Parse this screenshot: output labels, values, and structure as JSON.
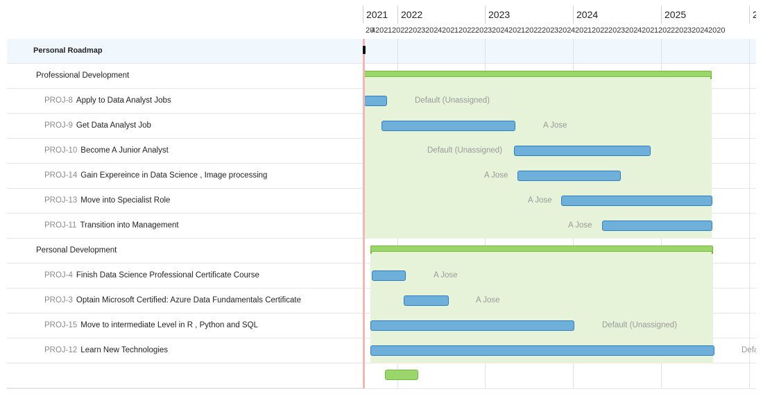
{
  "roadmap": {
    "title": "Personal Roadmap",
    "groups": [
      {
        "name": "Professional Development",
        "items": [
          {
            "key": "PROJ-8",
            "name": "Apply to Data Analyst Jobs",
            "assignee": "Default (Unassigned)"
          },
          {
            "key": "PROJ-9",
            "name": "Get Data Analyst Job",
            "assignee": "A Jose"
          },
          {
            "key": "PROJ-10",
            "name": "Become A Junior Analyst",
            "assignee": "Default (Unassigned)"
          },
          {
            "key": "PROJ-14",
            "name": "Gain Expereince in Data Science , Image processing",
            "assignee": "A Jose"
          },
          {
            "key": "PROJ-13",
            "name": "Move into Specialist Role",
            "assignee": "A Jose"
          },
          {
            "key": "PROJ-11",
            "name": "Transition into Management",
            "assignee": "A Jose"
          }
        ]
      },
      {
        "name": "Personal Development",
        "items": [
          {
            "key": "PROJ-4",
            "name": "Finish Data Science Professional Certificate Course",
            "assignee": "A Jose"
          },
          {
            "key": "PROJ-3",
            "name": "Optain Microsoft Certified: Azure Data Fundamentals Certificate",
            "assignee": "A Jose"
          },
          {
            "key": "PROJ-15",
            "name": "Move to intermediate Level in R , Python and SQL",
            "assignee": "Default (Unassigned)"
          },
          {
            "key": "PROJ-12",
            "name": "Learn New Technologies",
            "assignee": "Defa"
          }
        ]
      }
    ]
  },
  "timeline": {
    "years": [
      "2021",
      "2022",
      "2023",
      "2024",
      "2025",
      "2"
    ],
    "quarters": [
      "20",
      "4",
      "202",
      "1",
      "202",
      "2",
      "202",
      "3",
      "202",
      "4",
      "202",
      "1",
      "202",
      "2",
      "202",
      "3",
      "202",
      "4",
      "202",
      "1",
      "202",
      "2",
      "202",
      "3",
      "202",
      "4",
      "202",
      "1",
      "202",
      "2",
      "202",
      "3",
      "202",
      "4",
      "202",
      "1",
      "202",
      "2",
      "202",
      "3",
      "202",
      "4",
      "2020"
    ]
  },
  "colors": {
    "group_bar": "#9bd66a",
    "task_bar": "#6fb0da",
    "shade": "#e6f3d9",
    "today": "#f5b5b5"
  }
}
